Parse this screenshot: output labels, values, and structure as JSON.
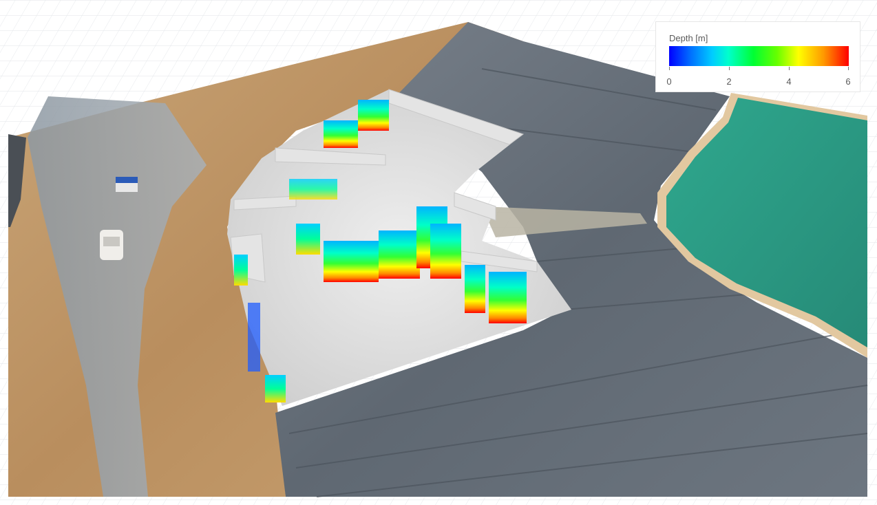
{
  "legend": {
    "title": "Depth [m]",
    "min": 0,
    "max": 6,
    "ticks": [
      "0",
      "2",
      "4",
      "6"
    ],
    "colors": [
      "#0000ff",
      "#00ccff",
      "#00ff33",
      "#ffff00",
      "#ff0000"
    ]
  },
  "scene": {
    "terrain_sand": "#c29a6b",
    "terrain_gravel": "#9aa3ab",
    "liner": "#6b737d",
    "pond_water": "#2f9b84",
    "shoreline": "#e2c8a0",
    "grid_line": "#e3e6ea"
  }
}
